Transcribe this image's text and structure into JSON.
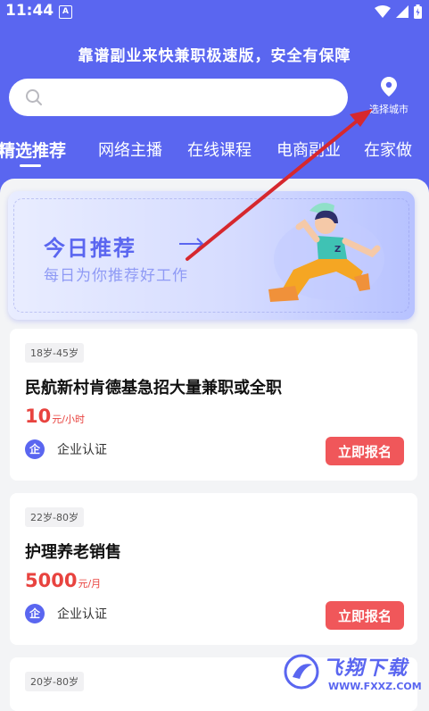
{
  "status_bar": {
    "time": "11:44",
    "notif_letter": "A"
  },
  "header": {
    "title": "靠谱副业来快兼职极速版，安全有保障"
  },
  "search": {
    "placeholder": ""
  },
  "city": {
    "label": "选择城市",
    "icon": "location-pin-icon"
  },
  "tabs": [
    {
      "label": "精选推荐",
      "active": true
    },
    {
      "label": "网络主播"
    },
    {
      "label": "在线课程"
    },
    {
      "label": "电商副业"
    },
    {
      "label": "在家做"
    }
  ],
  "banner": {
    "title": "今日推荐",
    "subtitle": "每日为你推荐好工作"
  },
  "jobs": [
    {
      "age": "18岁-45岁",
      "title": "民航新村肯德基急招大量兼职或全职",
      "salary": "10",
      "unit": "元/小时",
      "badge_icon": "企",
      "badge": "企业认证",
      "apply": "立即报名"
    },
    {
      "age": "22岁-80岁",
      "title": "护理养老销售",
      "salary": "5000",
      "unit": "元/月",
      "badge_icon": "企",
      "badge": "企业认证",
      "apply": "立即报名"
    },
    {
      "age": "20岁-80岁"
    }
  ],
  "watermark": {
    "text": "飞翔下载",
    "url": "WWW.FXXZ.COM"
  },
  "colors": {
    "primary": "#5a66f0",
    "salary": "#e8433f",
    "apply": "#f0575a",
    "annotation_arrow": "#d6282e"
  }
}
